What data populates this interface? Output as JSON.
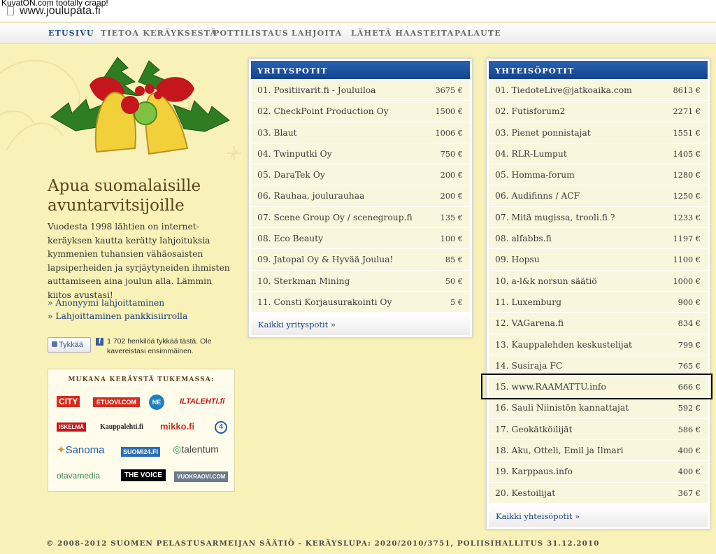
{
  "browser": {
    "url": "www.joulupata.fi",
    "watermark": "KuvatON.com tootally craap!"
  },
  "nav": [
    "ETUSIVU",
    "TIETOA KERÄYKSESTÄ",
    "POTTILISTAUS",
    "LAHJOITA",
    "LÄHETÄ HAASTEITA",
    "PALAUTE"
  ],
  "left": {
    "heading": "Apua suomalaisille avuntarvitsijoille",
    "intro": "Vuodesta 1998 lähtien on internet-keräyksen kautta kerätty lahjoituksia kymmenien tuhansien vähäosaisten lapsiperheiden ja syrjäytyneiden ihmisten auttamiseen aina joulun alla. Lämmin kiitos avustasi!",
    "links": [
      "» Anonyymi lahjoittaminen",
      "» Lahjoittaminen pankkisiirrolla"
    ],
    "like_button": "Tykkää",
    "like_text": "1 702 henkilöä tykkää tästä. Ole kavereistasi ensimmäinen.",
    "sponsors_title": "MUKANA KERÄYSTÄ TUKEMASSA:",
    "sponsors": [
      "CITY",
      "ETUOVI.COM",
      "NE",
      "ILTALEHTI.fi",
      "ISKELMÄ",
      "Kauppalehti.fi",
      "mikko.fi",
      "4",
      "Sanoma",
      "SUOMI24.FI",
      "talentum",
      "otavamedia",
      "THE VOICE",
      "VUOKRAOVI.COM"
    ]
  },
  "company_panel": {
    "title": "YRITYSPOTIT",
    "rows": [
      {
        "name": "01. Positiivarit.fi - Jouluiloa",
        "amount": "3675 €"
      },
      {
        "name": "02. CheckPoint Production Oy",
        "amount": "1500 €"
      },
      {
        "name": "03. Blaut",
        "amount": "1006 €"
      },
      {
        "name": "04. Twinputki Oy",
        "amount": "750 €"
      },
      {
        "name": "05. DaraTek Oy",
        "amount": "200 €"
      },
      {
        "name": "06. Rauhaa, joulurauhaa",
        "amount": "200 €"
      },
      {
        "name": "07. Scene Group Oy / scenegroup.fi",
        "amount": "135 €"
      },
      {
        "name": "08. Eco Beauty",
        "amount": "100 €"
      },
      {
        "name": "09. Jatopal Oy & Hyvää Joulua!",
        "amount": "85 €"
      },
      {
        "name": "10. Sterkman Mining",
        "amount": "50 €"
      },
      {
        "name": "11. Consti Korjausurakointi Oy",
        "amount": "5 €"
      }
    ],
    "more": "Kaikki yrityspotit »"
  },
  "community_panel": {
    "title": "YHTEISÖPOTIT",
    "rows": [
      {
        "name": "01. TiedoteLive@jatkoaika.com",
        "amount": "8613 €"
      },
      {
        "name": "02. Futisforum2",
        "amount": "2271 €"
      },
      {
        "name": "03. Pienet ponnistajat",
        "amount": "1551 €"
      },
      {
        "name": "04. RLR-Lumput",
        "amount": "1405 €"
      },
      {
        "name": "05. Homma-forum",
        "amount": "1280 €"
      },
      {
        "name": "06. Audifinns / ACF",
        "amount": "1250 €"
      },
      {
        "name": "07. Mitä mugissa, trooli.fi ?",
        "amount": "1233 €"
      },
      {
        "name": "08. alfabbs.fi",
        "amount": "1197 €"
      },
      {
        "name": "09. Hopsu",
        "amount": "1100 €"
      },
      {
        "name": "10. a-l&k norsun säätiö",
        "amount": "1000 €"
      },
      {
        "name": "11. Luxemburg",
        "amount": "900 €"
      },
      {
        "name": "12. VAGarena.fi",
        "amount": "834 €"
      },
      {
        "name": "13. Kauppalehden keskustelijat",
        "amount": "799 €"
      },
      {
        "name": "14. Susiraja FC",
        "amount": "765 €"
      },
      {
        "name": "15. www.RAAMATTU.info",
        "amount": "666 €"
      },
      {
        "name": "16. Sauli Niinistön kannattajat",
        "amount": "592 €"
      },
      {
        "name": "17. Geokätköilijät",
        "amount": "586 €"
      },
      {
        "name": "18. Aku, Otteli, Emil ja Ilmari",
        "amount": "400 €"
      },
      {
        "name": "19. Karppaus.info",
        "amount": "400 €"
      },
      {
        "name": "20. Kestoilijat",
        "amount": "367 €"
      }
    ],
    "more": "Kaikki yhteisöpotit »"
  },
  "footer": "© 2008-2012 SUOMEN PELASTUSARMEIJAN SÄÄTIÖ - KERÄYSLUPA: 2020/2010/3751, POLIISIHALLITUS 31.12.2010",
  "colors": {
    "accent": "#1d4f8a",
    "background": "#f8f1b8",
    "row": "#f8f7dd"
  }
}
